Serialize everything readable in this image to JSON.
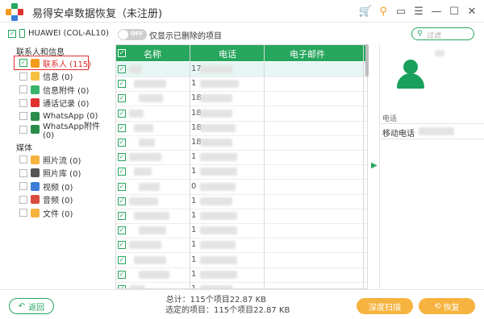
{
  "app": {
    "title": "易得安卓数据恢复（未注册)",
    "colors": {
      "accent": "#27a65d",
      "orange": "#f6b33f",
      "highlight": "#e0302f"
    }
  },
  "window_controls": [
    {
      "icon": "cart-icon",
      "glyph": "🛒"
    },
    {
      "icon": "key-icon",
      "glyph": "⚲"
    },
    {
      "icon": "chat-icon",
      "glyph": "▭"
    },
    {
      "icon": "menu-icon",
      "glyph": "☰"
    },
    {
      "icon": "minimize-icon",
      "glyph": "—"
    },
    {
      "icon": "maximize-icon",
      "glyph": "☐"
    },
    {
      "icon": "close-icon",
      "glyph": "✕"
    }
  ],
  "sidebar": {
    "device": "HUAWEI (COL-AL10)",
    "section_contacts": "联系人和信息",
    "section_media": "媒体",
    "contact_items": [
      {
        "label": "联系人 (115)",
        "icon": "contacts-icon",
        "color": "#f29b1d",
        "checked": true
      },
      {
        "label": "信息 (0)",
        "icon": "message-icon",
        "color": "#f6c142",
        "checked": false
      },
      {
        "label": "信息附件 (0)",
        "icon": "attachment-icon",
        "color": "#3ab36a",
        "checked": false
      },
      {
        "label": "通话记录 (0)",
        "icon": "call-log-icon",
        "color": "#e0302f",
        "checked": false
      },
      {
        "label": "WhatsApp (0)",
        "icon": "whatsapp-icon",
        "color": "#2a8b4a",
        "checked": false
      },
      {
        "label": "WhatsApp附件 (0)",
        "icon": "whatsapp-attachment-icon",
        "color": "#2a8b4a",
        "checked": false
      }
    ],
    "media_items": [
      {
        "label": "照片流 (0)",
        "icon": "photo-stream-icon",
        "color": "#f6b33f",
        "checked": false
      },
      {
        "label": "照片库 (0)",
        "icon": "photo-library-icon",
        "color": "#555555",
        "checked": false
      },
      {
        "label": "视频 (0)",
        "icon": "video-icon",
        "color": "#3b7dd8",
        "checked": false
      },
      {
        "label": "音频 (0)",
        "icon": "audio-icon",
        "color": "#d94c3d",
        "checked": false
      },
      {
        "label": "文件 (0)",
        "icon": "file-icon",
        "color": "#f6b33f",
        "checked": false
      }
    ]
  },
  "toolbar": {
    "toggle_label": "OFF",
    "filter_label": "仅显示已删除的项目",
    "search_placeholder": "过滤"
  },
  "table": {
    "columns": [
      "名称",
      "电话",
      "电子邮件"
    ],
    "rows": [
      {
        "phone_prefix": "17"
      },
      {
        "phone_prefix": "1"
      },
      {
        "phone_prefix": "18"
      },
      {
        "phone_prefix": "18"
      },
      {
        "phone_prefix": "18"
      },
      {
        "phone_prefix": "18"
      },
      {
        "phone_prefix": "1"
      },
      {
        "phone_prefix": "1"
      },
      {
        "phone_prefix": "0"
      },
      {
        "phone_prefix": "1"
      },
      {
        "phone_prefix": "1"
      },
      {
        "phone_prefix": "1"
      },
      {
        "phone_prefix": "1"
      },
      {
        "phone_prefix": "1"
      },
      {
        "phone_prefix": "1"
      },
      {
        "phone_prefix": "1"
      },
      {
        "phone_prefix": "15"
      }
    ]
  },
  "detail": {
    "field_label": "电话",
    "field_value": "移动电话"
  },
  "footer": {
    "back_label": "返回",
    "total_line": "总计：115个项目22.87 KB",
    "selected_line": "选定的项目：115个项目22.87 KB",
    "deep_scan_label": "深度扫描",
    "recover_label": "恢复"
  }
}
